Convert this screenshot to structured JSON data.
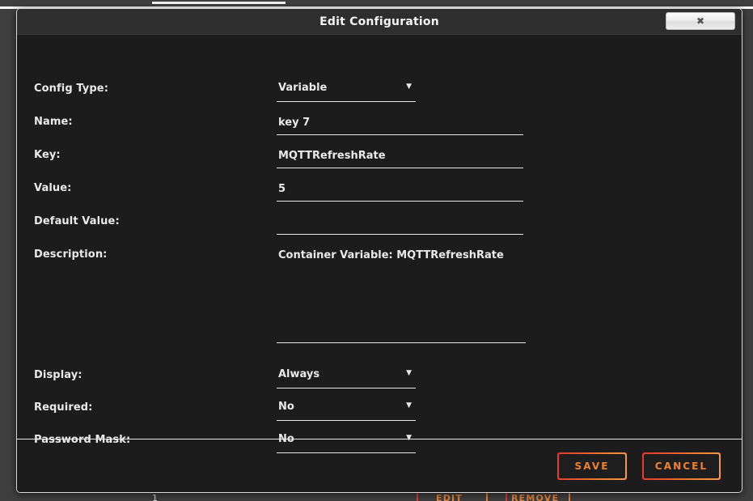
{
  "background": {
    "row_number": "1",
    "edit_label": "EDIT",
    "remove_label": "REMOVE",
    "accent_red": "#e5372c",
    "accent_orange": "#f0822c"
  },
  "modal": {
    "title": "Edit Configuration",
    "close_icon": "close-icon",
    "close_glyph": "✖",
    "fields": [
      {
        "label": "Config Type:",
        "name": "config-type",
        "type": "select",
        "value": "Variable",
        "arrow": "▼"
      },
      {
        "label": "Name:",
        "name": "name",
        "type": "text",
        "value": "key 7",
        "placeholder": ""
      },
      {
        "label": "Key:",
        "name": "key",
        "type": "text",
        "value": "MQTTRefreshRate",
        "placeholder": ""
      },
      {
        "label": "Value:",
        "name": "value",
        "type": "text",
        "value": "5",
        "placeholder": ""
      },
      {
        "label": "Default Value:",
        "name": "default-value",
        "type": "text",
        "value": "",
        "placeholder": ""
      },
      {
        "label": "Description:",
        "name": "description",
        "type": "textarea",
        "value": "Container Variable: MQTTRefreshRate",
        "placeholder": ""
      },
      {
        "label": "Display:",
        "name": "display",
        "type": "select",
        "value": "Always",
        "arrow": "▼"
      },
      {
        "label": "Required:",
        "name": "required",
        "type": "select",
        "value": "No",
        "arrow": "▼"
      },
      {
        "label": "Password Mask:",
        "name": "password-mask",
        "type": "select",
        "value": "No",
        "arrow": "▼"
      }
    ],
    "footer": {
      "save_label": "SAVE",
      "cancel_label": "CANCEL"
    }
  }
}
